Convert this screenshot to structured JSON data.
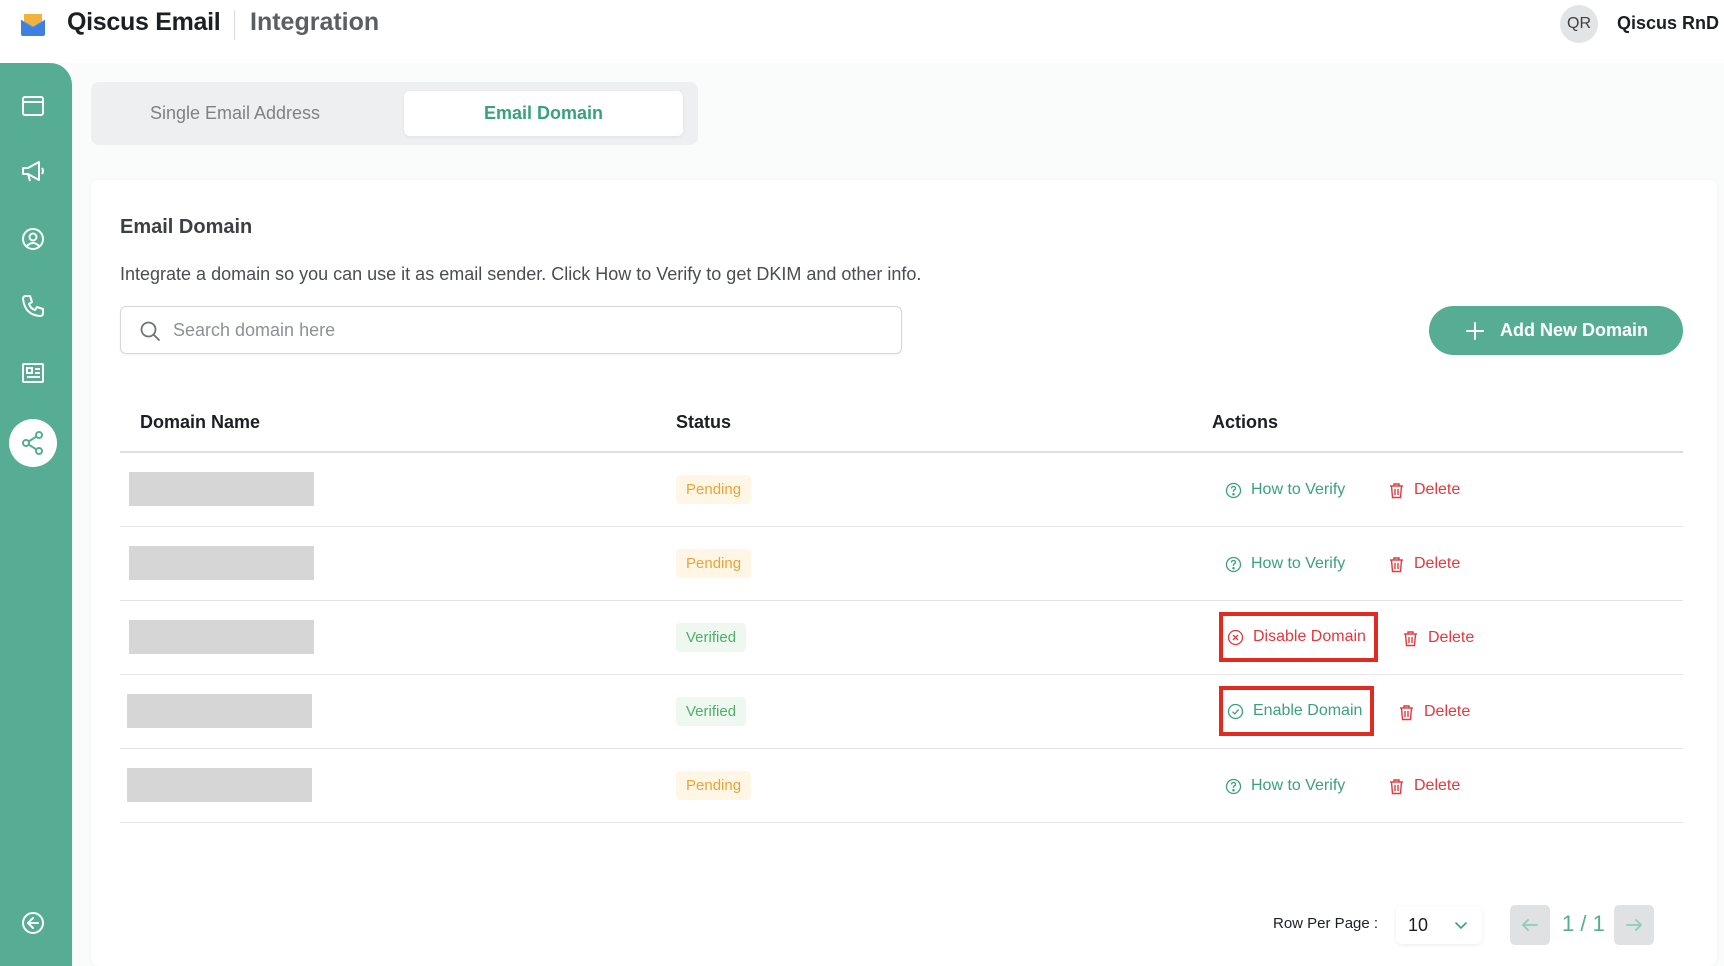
{
  "header": {
    "brand": "Qiscus Email",
    "page_title": "Integration",
    "avatar_initials": "QR",
    "user_name": "Qiscus RnD"
  },
  "sidebar": {
    "items": [
      {
        "icon": "browser-window-icon"
      },
      {
        "icon": "megaphone-icon"
      },
      {
        "icon": "user-circle-icon"
      },
      {
        "icon": "phone-icon"
      },
      {
        "icon": "newspaper-icon"
      },
      {
        "icon": "share-nodes-icon",
        "active": true
      },
      {
        "icon": "collapse-arrow-icon"
      }
    ]
  },
  "tabs": {
    "single": "Single Email Address",
    "domain": "Email Domain",
    "active": "domain"
  },
  "card": {
    "title": "Email Domain",
    "description": "Integrate a domain so you can use it as email sender. Click How to Verify to get DKIM and other info."
  },
  "search": {
    "placeholder": "Search domain here",
    "value": ""
  },
  "add_button": "Add New Domain",
  "table": {
    "columns": [
      "Domain Name",
      "Status",
      "Actions"
    ],
    "rows": [
      {
        "domain": "",
        "status": "Pending",
        "primary_action": "How to Verify",
        "secondary_action": "Delete"
      },
      {
        "domain": "",
        "status": "Pending",
        "primary_action": "How to Verify",
        "secondary_action": "Delete"
      },
      {
        "domain": "",
        "status": "Verified",
        "primary_action": "Disable Domain",
        "secondary_action": "Delete"
      },
      {
        "domain": "",
        "status": "Verified",
        "primary_action": "Enable Domain",
        "secondary_action": "Delete"
      },
      {
        "domain": "",
        "status": "Pending",
        "primary_action": "How to Verify",
        "secondary_action": "Delete"
      }
    ]
  },
  "pagination": {
    "rows_per_page_label": "Row Per Page :",
    "rows_per_page": "10",
    "page_indicator": "1 / 1"
  },
  "colors": {
    "accent": "#56ad93",
    "accent_text": "#3aa07f",
    "danger": "#e0393e",
    "pending": "#e8a33a",
    "verified": "#4fae6a",
    "highlight_box": "#e02b20"
  }
}
